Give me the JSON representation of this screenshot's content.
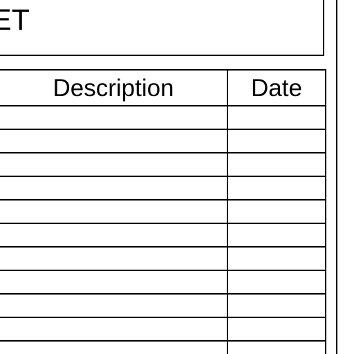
{
  "header": {
    "title_visible": "ET"
  },
  "table": {
    "columns": [
      "Description",
      "Date"
    ],
    "rows": [
      [
        "",
        ""
      ],
      [
        "",
        ""
      ],
      [
        "",
        ""
      ],
      [
        "",
        ""
      ],
      [
        "",
        ""
      ],
      [
        "",
        ""
      ],
      [
        "",
        ""
      ],
      [
        "",
        ""
      ],
      [
        "",
        ""
      ],
      [
        "",
        ""
      ],
      [
        "",
        ""
      ]
    ]
  }
}
